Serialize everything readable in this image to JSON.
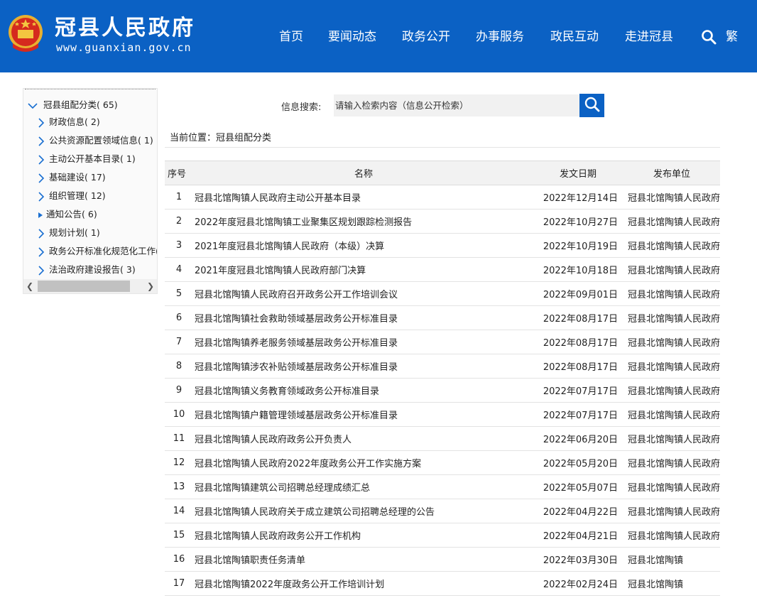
{
  "header": {
    "site_title": "冠县人民政府",
    "site_url": "www.guanxian.gov.cn",
    "nav": [
      "首页",
      "要闻动态",
      "政务公开",
      "办事服务",
      "政民互动",
      "走进冠县"
    ],
    "traditional": "繁"
  },
  "sidebar": {
    "root": {
      "label": "冠县组配分类",
      "count": "( 65)"
    },
    "items": [
      {
        "label": "财政信息",
        "count": "( 2)"
      },
      {
        "label": "公共资源配置领域信息",
        "count": "( 1)"
      },
      {
        "label": "主动公开基本目录",
        "count": "( 1)"
      },
      {
        "label": "基础建设",
        "count": "( 17)"
      },
      {
        "label": "组织管理",
        "count": "( 12)"
      },
      {
        "label": "通知公告",
        "count": "( 6)"
      },
      {
        "label": "规划计划",
        "count": "( 1)"
      },
      {
        "label": "政务公开标准化规范化工作",
        "count": "("
      },
      {
        "label": "法治政府建设报告",
        "count": "( 3)"
      }
    ]
  },
  "search": {
    "label": "信息搜索:",
    "placeholder": "请输入检索内容（信息公开检索）"
  },
  "breadcrumb": "当前位置：冠县组配分类",
  "table": {
    "headers": [
      "序号",
      "名称",
      "发文日期",
      "发布单位"
    ],
    "rows": [
      {
        "num": "1",
        "name": "冠县北馆陶镇人民政府主动公开基本目录",
        "date": "2022年12月14日",
        "unit": "冠县北馆陶镇人民政府"
      },
      {
        "num": "2",
        "name": "2022年度冠县北馆陶镇工业聚集区规划跟踪检测报告",
        "date": "2022年10月27日",
        "unit": "冠县北馆陶镇人民政府"
      },
      {
        "num": "3",
        "name": "2021年度冠县北馆陶镇人民政府（本级）决算",
        "date": "2022年10月19日",
        "unit": "冠县北馆陶镇人民政府"
      },
      {
        "num": "4",
        "name": "2021年度冠县北馆陶镇人民政府部门决算",
        "date": "2022年10月18日",
        "unit": "冠县北馆陶镇人民政府"
      },
      {
        "num": "5",
        "name": "冠县北馆陶镇人民政府召开政务公开工作培训会议",
        "date": "2022年09月01日",
        "unit": "冠县北馆陶镇人民政府"
      },
      {
        "num": "6",
        "name": "冠县北馆陶镇社会救助领域基层政务公开标准目录",
        "date": "2022年08月17日",
        "unit": "冠县北馆陶镇人民政府"
      },
      {
        "num": "7",
        "name": "冠县北馆陶镇养老服务领域基层政务公开标准目录",
        "date": "2022年08月17日",
        "unit": "冠县北馆陶镇人民政府"
      },
      {
        "num": "8",
        "name": "冠县北馆陶镇涉农补贴领域基层政务公开标准目录",
        "date": "2022年08月17日",
        "unit": "冠县北馆陶镇人民政府"
      },
      {
        "num": "9",
        "name": "冠县北馆陶镇义务教育领域政务公开标准目录",
        "date": "2022年07月17日",
        "unit": "冠县北馆陶镇人民政府"
      },
      {
        "num": "10",
        "name": "冠县北馆陶镇户籍管理领域基层政务公开标准目录",
        "date": "2022年07月17日",
        "unit": "冠县北馆陶镇人民政府"
      },
      {
        "num": "11",
        "name": "冠县北馆陶镇人民政府政务公开负责人",
        "date": "2022年06月20日",
        "unit": "冠县北馆陶镇人民政府"
      },
      {
        "num": "12",
        "name": "冠县北馆陶镇人民政府2022年度政务公开工作实施方案",
        "date": "2022年05月20日",
        "unit": "冠县北馆陶镇人民政府"
      },
      {
        "num": "13",
        "name": "冠县北馆陶镇建筑公司招聘总经理成绩汇总",
        "date": "2022年05月07日",
        "unit": "冠县北馆陶镇人民政府"
      },
      {
        "num": "14",
        "name": "冠县北馆陶镇人民政府关于成立建筑公司招聘总经理的公告",
        "date": "2022年04月22日",
        "unit": "冠县北馆陶镇人民政府"
      },
      {
        "num": "15",
        "name": "冠县北馆陶镇人民政府政务公开工作机构",
        "date": "2022年04月21日",
        "unit": "冠县北馆陶镇人民政府"
      },
      {
        "num": "16",
        "name": "冠县北馆陶镇职责任务清单",
        "date": "2022年03月30日",
        "unit": "冠县北馆陶镇"
      },
      {
        "num": "17",
        "name": "冠县北馆陶镇2022年度政务公开工作培训计划",
        "date": "2022年02月24日",
        "unit": "冠县北馆陶镇"
      }
    ]
  },
  "colors": {
    "brand_blue": "#0b61c4",
    "header_text": "#ffffff"
  },
  "icons": {
    "search": "search-icon",
    "emblem": "national-emblem-icon",
    "expand": "chevron-down-icon",
    "collapsed": "chevron-right-icon",
    "selected": "triangle-right-icon"
  }
}
